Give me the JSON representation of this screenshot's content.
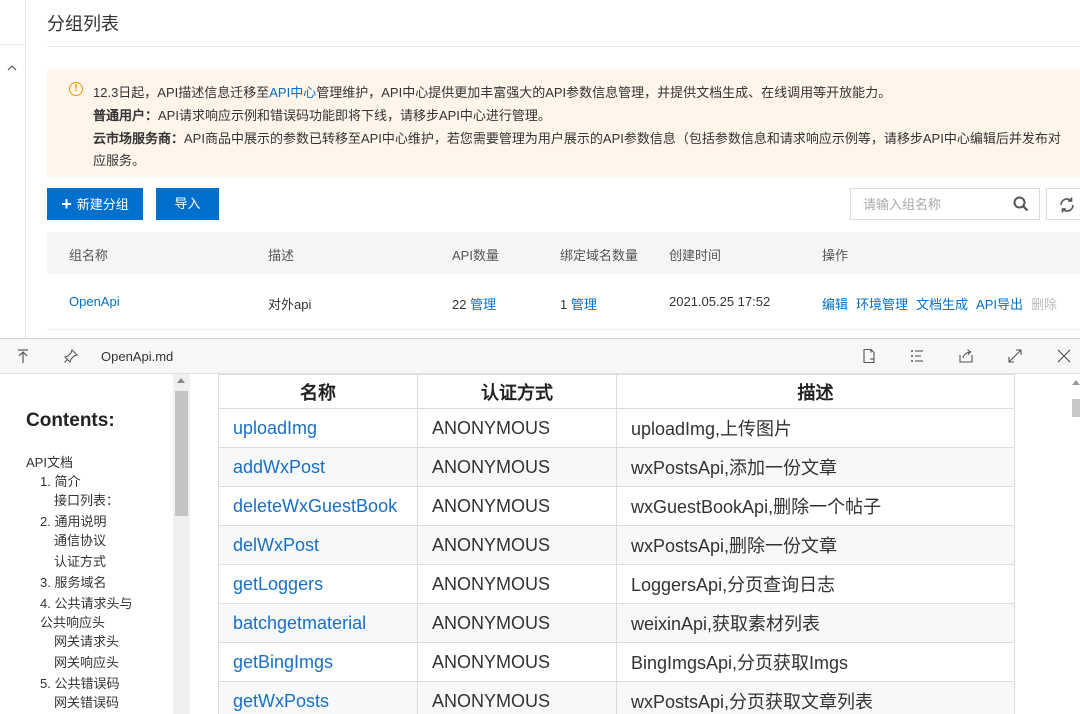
{
  "console": {
    "page_title": "分组列表",
    "notice": {
      "line1_a": "12.3日起，API描述信息迁移至",
      "line1_link": "API中心",
      "line1_b": "管理维护，API中心提供更加丰富强大的API参数信息管理，并提供文档生成、在线调用等开放能力。",
      "line2_bold": "普通用户：",
      "line2_text": "API请求响应示例和错误码功能即将下线，请移步API中心进行管理。",
      "line3_bold": "云市场服务商：",
      "line3_text": "API商品中展示的参数已转移至API中心维护，若您需要管理为用户展示的API参数信息（包括参数信息和请求响应示例等，请移步API中心编辑后并发布对",
      "line4_text": "应服务。"
    },
    "new_group_label": "新建分组",
    "import_label": "导入",
    "search_placeholder": "请输入组名称",
    "table": {
      "headers": [
        "组名称",
        "描述",
        "API数量",
        "绑定域名数量",
        "创建时间",
        "操作"
      ],
      "row": {
        "name": "OpenApi",
        "description": "对外api",
        "api_count": "22",
        "api_manage": "管理",
        "domain_count": "1",
        "domain_manage": "管理",
        "created": "2021.05.25 17:52",
        "actions": [
          "编辑",
          "环境管理",
          "文档生成",
          "API导出"
        ],
        "delete": "删除"
      }
    }
  },
  "viewer": {
    "filename": "OpenApi.md",
    "toc": {
      "title": "Contents:",
      "items": [
        "API文档",
        "1. 简介",
        "接口列表：",
        "2. 通用说明",
        "通信协议",
        "认证方式",
        "3. 服务域名",
        "4. 公共请求头与",
        "公共响应头",
        "网关请求头",
        "网关响应头",
        "5. 公共错误码",
        "网关错误码"
      ]
    },
    "table": {
      "headers": [
        "名称",
        "认证方式",
        "描述"
      ],
      "rows": [
        [
          "uploadImg",
          "ANONYMOUS",
          "uploadImg,上传图片"
        ],
        [
          "addWxPost",
          "ANONYMOUS",
          "wxPostsApi,添加一份文章"
        ],
        [
          "deleteWxGuestBook",
          "ANONYMOUS",
          "wxGuestBookApi,删除一个帖子"
        ],
        [
          "delWxPost",
          "ANONYMOUS",
          "wxPostsApi,删除一份文章"
        ],
        [
          "getLoggers",
          "ANONYMOUS",
          "LoggersApi,分页查询日志"
        ],
        [
          "batchgetmaterial",
          "ANONYMOUS",
          "weixinApi,获取素材列表"
        ],
        [
          "getBingImgs",
          "ANONYMOUS",
          "BingImgsApi,分页获取Imgs"
        ],
        [
          "getWxPosts",
          "ANONYMOUS",
          "wxPostsApi,分页获取文章列表"
        ]
      ]
    }
  },
  "colors": {
    "accent": "#0070cc",
    "notice_bg": "#fff5eb",
    "warning": "#f39800"
  }
}
